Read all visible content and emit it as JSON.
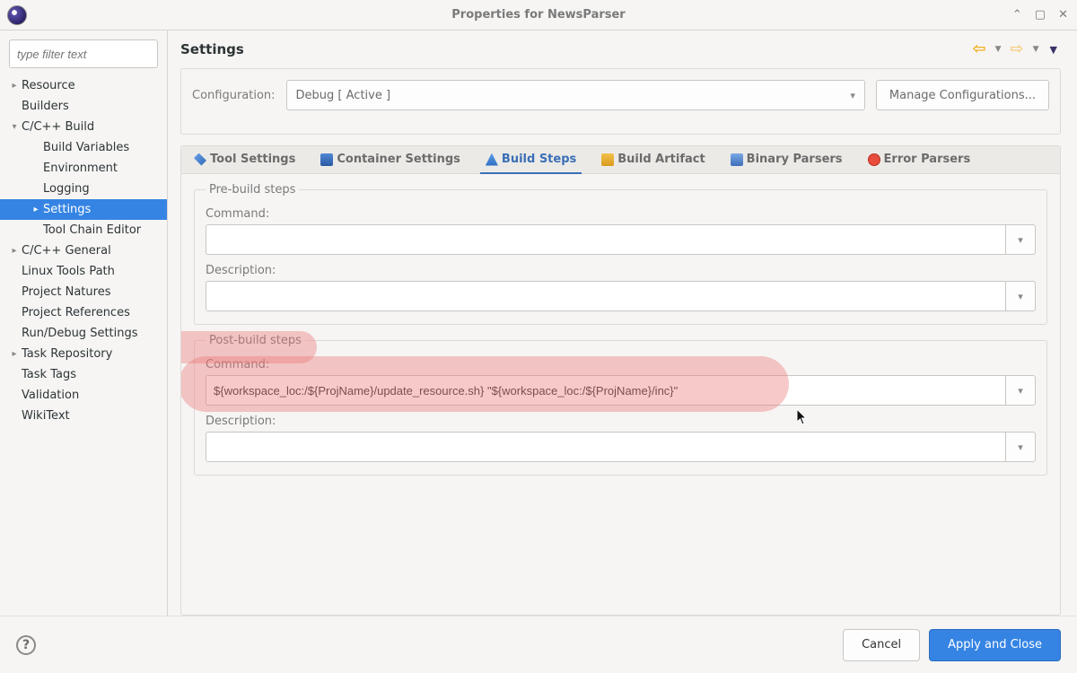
{
  "window": {
    "title": "Properties for NewsParser"
  },
  "sidebar": {
    "filter_placeholder": "type filter text",
    "items": [
      {
        "label": "Resource",
        "depth": 0,
        "twisty": "▸",
        "selected": false
      },
      {
        "label": "Builders",
        "depth": 0,
        "twisty": "",
        "selected": false
      },
      {
        "label": "C/C++ Build",
        "depth": 0,
        "twisty": "▾",
        "selected": false
      },
      {
        "label": "Build Variables",
        "depth": 1,
        "twisty": "",
        "selected": false
      },
      {
        "label": "Environment",
        "depth": 1,
        "twisty": "",
        "selected": false
      },
      {
        "label": "Logging",
        "depth": 1,
        "twisty": "",
        "selected": false
      },
      {
        "label": "Settings",
        "depth": 1,
        "twisty": "",
        "selected": true
      },
      {
        "label": "Tool Chain Editor",
        "depth": 1,
        "twisty": "",
        "selected": false
      },
      {
        "label": "C/C++ General",
        "depth": 0,
        "twisty": "▸",
        "selected": false
      },
      {
        "label": "Linux Tools Path",
        "depth": 0,
        "twisty": "",
        "selected": false
      },
      {
        "label": "Project Natures",
        "depth": 0,
        "twisty": "",
        "selected": false
      },
      {
        "label": "Project References",
        "depth": 0,
        "twisty": "",
        "selected": false
      },
      {
        "label": "Run/Debug Settings",
        "depth": 0,
        "twisty": "",
        "selected": false
      },
      {
        "label": "Task Repository",
        "depth": 0,
        "twisty": "▸",
        "selected": false
      },
      {
        "label": "Task Tags",
        "depth": 0,
        "twisty": "",
        "selected": false
      },
      {
        "label": "Validation",
        "depth": 0,
        "twisty": "",
        "selected": false
      },
      {
        "label": "WikiText",
        "depth": 0,
        "twisty": "",
        "selected": false
      }
    ]
  },
  "heading": {
    "title": "Settings"
  },
  "config": {
    "label": "Configuration:",
    "value": "Debug  [ Active ]",
    "manage_label": "Manage Configurations..."
  },
  "tabs": [
    {
      "label": "Tool Settings",
      "active": false
    },
    {
      "label": "Container Settings",
      "active": false
    },
    {
      "label": "Build Steps",
      "active": true
    },
    {
      "label": "Build Artifact",
      "active": false
    },
    {
      "label": "Binary Parsers",
      "active": false
    },
    {
      "label": "Error Parsers",
      "active": false
    }
  ],
  "pre": {
    "legend": "Pre-build steps",
    "cmd_label": "Command:",
    "cmd_value": "",
    "desc_label": "Description:",
    "desc_value": ""
  },
  "post": {
    "legend": "Post-build steps",
    "cmd_label": "Command:",
    "cmd_value": "${workspace_loc:/${ProjName}/update_resource.sh} \"${workspace_loc:/${ProjName}/inc}\"",
    "desc_label": "Description:",
    "desc_value": ""
  },
  "footer": {
    "cancel": "Cancel",
    "apply_close": "Apply and Close",
    "help": "?"
  }
}
